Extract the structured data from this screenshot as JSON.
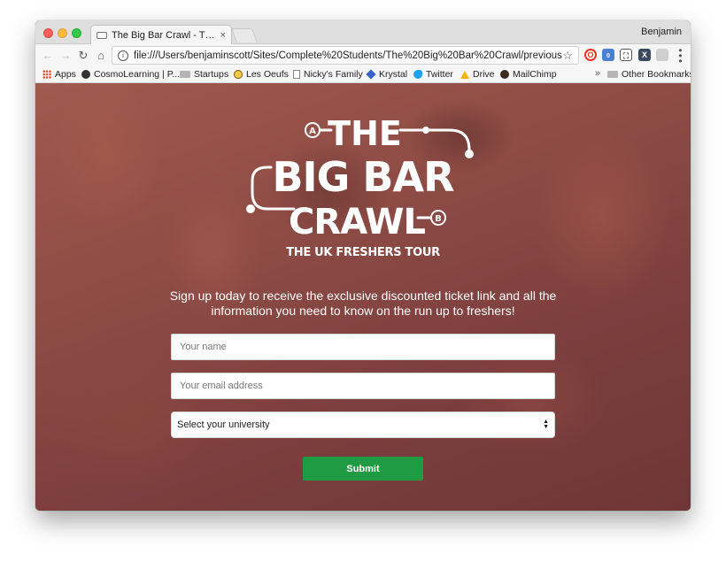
{
  "browser": {
    "tab_title": "The Big Bar Crawl - The UK Fr",
    "tab_close": "×",
    "profile_name": "Benjamin",
    "url": "file:///Users/benjaminscott/Sites/Complete%20Students/The%20Big%20Bar%20Crawl/previous%20(c...",
    "nav_icons": [
      "back-arrow-icon",
      "forward-arrow-icon",
      "reload-icon",
      "home-icon"
    ],
    "extension_badge": "0",
    "bookmarks": [
      {
        "label": "Apps",
        "icon": "apps-grid-icon"
      },
      {
        "label": "CosmoLearning | P...",
        "icon": "cosmo-icon"
      },
      {
        "label": "Startups",
        "icon": "folder-icon"
      },
      {
        "label": "Les Oeufs",
        "icon": "egg-icon"
      },
      {
        "label": "Nicky's Family",
        "icon": "page-icon"
      },
      {
        "label": "Krystal",
        "icon": "krystal-icon"
      },
      {
        "label": "Twitter",
        "icon": "twitter-bird-icon"
      },
      {
        "label": "Drive",
        "icon": "drive-icon"
      },
      {
        "label": "MailChimp",
        "icon": "mailchimp-icon"
      }
    ],
    "bookmarks_overflow": "»",
    "other_bookmarks": "Other Bookmarks"
  },
  "logo": {
    "line1": "THE",
    "line2": "BIG BAR",
    "line3": "CRAWL",
    "marker_a": "A",
    "marker_b": "B"
  },
  "tagline": "THE UK FRESHERS TOUR",
  "intro_text": "Sign up today to receive the exclusive discounted ticket link and all the information you need to know on the run up to freshers!",
  "form": {
    "name_placeholder": "Your name",
    "email_placeholder": "Your email address",
    "university_selected": "Select your university",
    "submit_label": "Submit"
  },
  "colors": {
    "overlay": "#8b4a43",
    "submit": "#1f9b44",
    "text": "#ffffff"
  }
}
